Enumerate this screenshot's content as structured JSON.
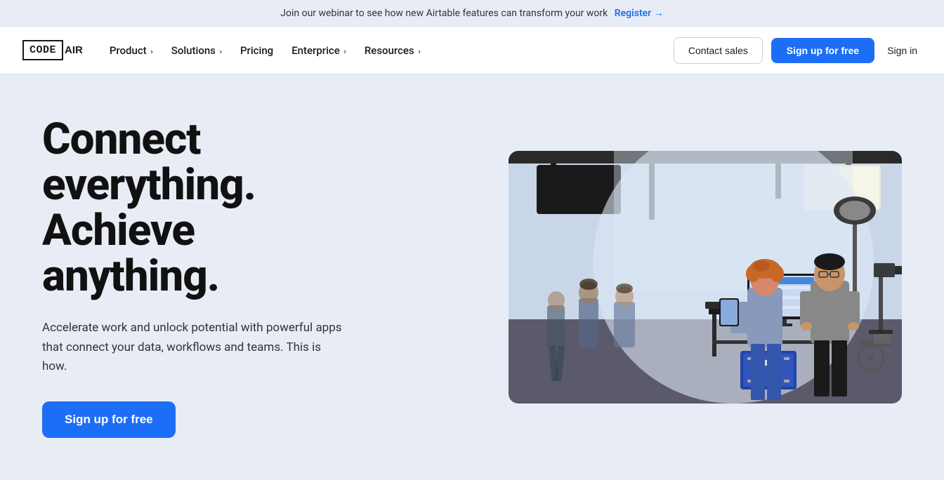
{
  "announcement": {
    "text": "Join our webinar to see how new Airtable features can transform your work",
    "link_text": "Register",
    "link_arrow": "→"
  },
  "nav": {
    "logo_code": "CODE",
    "logo_air": "AIR",
    "links": [
      {
        "label": "Product",
        "has_chevron": true
      },
      {
        "label": "Solutions",
        "has_chevron": true
      },
      {
        "label": "Pricing",
        "has_chevron": false
      },
      {
        "label": "Enterprice",
        "has_chevron": true
      },
      {
        "label": "Resources",
        "has_chevron": true
      }
    ],
    "contact_sales": "Contact sales",
    "signup": "Sign up for free",
    "signin": "Sign in"
  },
  "hero": {
    "title_line1": "Connect",
    "title_line2": "everything.",
    "title_line3": "Achieve",
    "title_line4": "anything.",
    "subtitle": "Accelerate work and unlock potential with powerful apps that connect your data, workflows and teams. This is how.",
    "cta": "Sign up for free"
  },
  "colors": {
    "accent_blue": "#1d6ef6",
    "background": "#e8edf5",
    "text_dark": "#111111"
  }
}
